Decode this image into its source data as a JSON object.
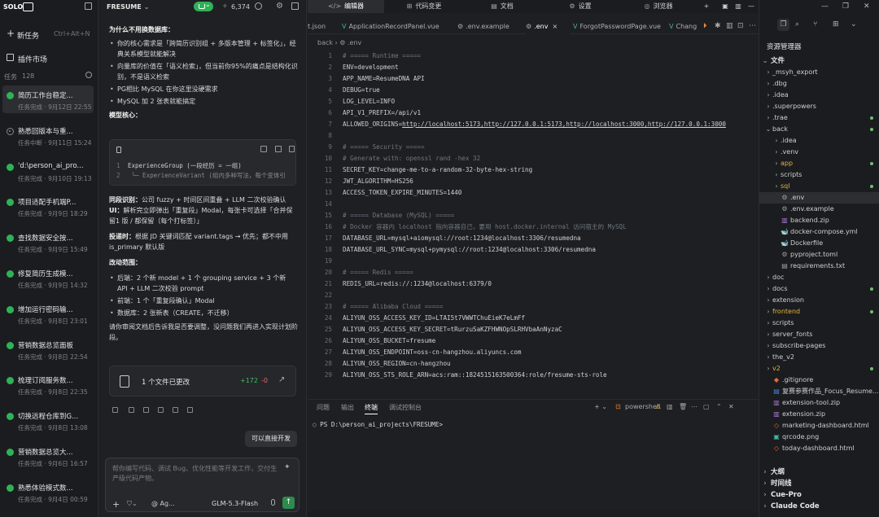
{
  "left": {
    "brand": "SOLO",
    "new_task": "新任务",
    "new_task_kbd": "Ctrl+Alt+N",
    "plugins": "插件市场",
    "tasks_label": "任务",
    "tasks_count": "128",
    "tasks": [
      {
        "title": "简历工作台稳定...",
        "sub": "任务完成 · 9月12日 22:55",
        "status": "done"
      },
      {
        "title": "熟悉回版本与重...",
        "sub": "任务中断 · 9月11日 15:24",
        "status": "interrupted"
      },
      {
        "title": "'d:\\person_ai_pro...",
        "sub": "任务完成 · 9月10日 19:13",
        "status": "done"
      },
      {
        "title": "项目适配手机端P...",
        "sub": "任务完成 · 9月9日 18:29",
        "status": "done"
      },
      {
        "title": "查找数据安全按...",
        "sub": "任务完成 · 9月9日 15:49",
        "status": "done"
      },
      {
        "title": "修复简历生成模...",
        "sub": "任务完成 · 9月9日 14:32",
        "status": "done"
      },
      {
        "title": "增加运行密码输...",
        "sub": "任务完成 · 9月8日 23:01",
        "status": "done"
      },
      {
        "title": "营销数据总览面板",
        "sub": "任务完成 · 9月8日 22:54",
        "status": "done"
      },
      {
        "title": "梳理订阅服务数...",
        "sub": "任务完成 · 9月8日 22:35",
        "status": "done"
      },
      {
        "title": "切换远程仓库到G...",
        "sub": "任务完成 · 9月8日 13:08",
        "status": "done"
      },
      {
        "title": "营销数据总览大...",
        "sub": "任务完成 · 9月6日 16:57",
        "status": "done"
      },
      {
        "title": "熟悉体验模式数...",
        "sub": "任务完成 · 9月4日 00:59",
        "status": "done"
      }
    ]
  },
  "chat": {
    "project": "FRESUME",
    "star_count": "6,374",
    "heading1": "为什么不用换数据库：",
    "bullets1": [
      "你的核心需求是「跨简历识别组 + 多版本管理 + 标签化」，经典关系模型就能解决",
      "向量库的价值在「语义检索」，但当前你95%的痛点是结构化识别，不是语义检索",
      "PG相比 MySQL 在你这里没硬需求",
      "MySQL 加 2 张表就能搞定"
    ],
    "heading2": "模型核心：",
    "code_lines": [
      {
        "n": "1",
        "code": "ExperienceGroup (一段经历 = 一组)"
      },
      {
        "n": "2",
        "code": "  └─ ExperienceVariant (组内多种写法，每个变体引"
      }
    ],
    "para1_bold": "同段识别：",
    "para1": "公司 fuzzy + 时间区间重叠 + LLM 二次校验确认",
    "para2_bold": "UI：",
    "para2": "解析完立即弹出「重复段」Modal，每张卡可选择「合并保留1 版 / 都保留（每个打标签）」",
    "para3_bold": "投递时：",
    "para3": "根据 JD 关键词匹配 variant.tags → 优先；都不中用 is_primary 默认版",
    "heading3": "改动范围：",
    "bullets2": [
      "后端：2 个新 model + 1 个 grouping service + 3 个新 API + LLM 二次校验 prompt",
      "前端：1 个「重复段确认」Modal",
      "数据库：2 张新表（CREATE，不迁移）"
    ],
    "closing": "请你审阅文档后告诉我是否要调整，没问题我们再进入实现计划阶段。",
    "file_change": "1 个文件已更改",
    "adds": "+172",
    "dels": "-0",
    "user_bubble": "可以直接开发",
    "input_placeholder": "帮你编写代码、调试 Bug、优化性能等开发工作，交付生产级代码产物。",
    "agent": "@ Ag...",
    "model": "GLM-5.3-Flash"
  },
  "editor": {
    "top_tabs": [
      "编辑器",
      "代码变更",
      "文档",
      "设置",
      "浏览器"
    ],
    "file_tabs": [
      {
        "name": "t.json",
        "icon": ""
      },
      {
        "name": "ApplicationRecordPanel.vue",
        "icon": "vue"
      },
      {
        "name": ".env.example",
        "icon": "settings"
      },
      {
        "name": ".env",
        "icon": "settings"
      },
      {
        "name": "ForgotPasswordPage.vue",
        "icon": "vue"
      },
      {
        "name": "Chang",
        "icon": "vue"
      }
    ],
    "breadcrumb": "back  ›  ⚙ .env",
    "lines": [
      {
        "n": "1",
        "t": "c",
        "text": "# ===== Runtime ====="
      },
      {
        "n": "2",
        "t": "kv",
        "k": "ENV",
        "v": "development"
      },
      {
        "n": "3",
        "t": "kv",
        "k": "APP_NAME",
        "v": "ResumeDNA API"
      },
      {
        "n": "4",
        "t": "kv",
        "k": "DEBUG",
        "v": "true"
      },
      {
        "n": "5",
        "t": "kv",
        "k": "LOG_LEVEL",
        "v": "INFO"
      },
      {
        "n": "6",
        "t": "kv",
        "k": "API_V1_PREFIX",
        "v": "/api/v1"
      },
      {
        "n": "7",
        "t": "kv",
        "k": "ALLOWED_ORIGINS",
        "v": "http://localhost:5173,http://127.0.0.1:5173,http://localhost:3000,http://127.0.0.1:3000",
        "link": true
      },
      {
        "n": "8",
        "t": "blank"
      },
      {
        "n": "9",
        "t": "c",
        "text": "# ===== Security ====="
      },
      {
        "n": "10",
        "t": "c",
        "text": "# Generate with: openssl rand -hex 32"
      },
      {
        "n": "11",
        "t": "kv",
        "k": "SECRET_KEY",
        "v": "change-me-to-a-random-32-byte-hex-string"
      },
      {
        "n": "12",
        "t": "kv",
        "k": "JWT_ALGORITHM",
        "v": "HS256"
      },
      {
        "n": "13",
        "t": "kv",
        "k": "ACCESS_TOKEN_EXPIRE_MINUTES",
        "v": "1440"
      },
      {
        "n": "14",
        "t": "blank"
      },
      {
        "n": "15",
        "t": "c",
        "text": "# ===== Database (MySQL) ====="
      },
      {
        "n": "16",
        "t": "c",
        "text": "# Docker 容器内 localhost 指向容器自己，要用 host.docker.internal 访问宿主的 MySQL"
      },
      {
        "n": "17",
        "t": "kv",
        "k": "DATABASE_URL",
        "v": "mysql+aiomysql://root:1234@localhost:3306/resumedna"
      },
      {
        "n": "18",
        "t": "kv",
        "k": "DATABASE_URL_SYNC",
        "v": "mysql+pymysql://root:1234@localhost:3306/resumedna"
      },
      {
        "n": "19",
        "t": "blank"
      },
      {
        "n": "20",
        "t": "c",
        "text": "# ===== Redis ====="
      },
      {
        "n": "21",
        "t": "kv",
        "k": "REDIS_URL",
        "v": "redis://:1234@localhost:6379/0"
      },
      {
        "n": "22",
        "t": "blank"
      },
      {
        "n": "23",
        "t": "c",
        "text": "# ===== Alibaba Cloud ====="
      },
      {
        "n": "24",
        "t": "kv",
        "k": "ALIYUN_OSS_ACCESS_KEY_ID",
        "v": "LTAI5t7VWWTChuEieK7eLmFf"
      },
      {
        "n": "25",
        "t": "kv",
        "k": "ALIYUN_OSS_ACCESS_KEY_SECRET",
        "v": "tRurzuSaKZFHWNOpSLRHVbaAnNyzaC"
      },
      {
        "n": "26",
        "t": "kv",
        "k": "ALIYUN_OSS_BUCKET",
        "v": "fresume"
      },
      {
        "n": "27",
        "t": "kv",
        "k": "ALIYUN_OSS_ENDPOINT",
        "v": "oss-cn-hangzhou.aliyuncs.com"
      },
      {
        "n": "28",
        "t": "kv",
        "k": "ALIYUN_OSS_REGION",
        "v": "cn-hangzhou"
      },
      {
        "n": "29",
        "t": "kv",
        "k": "ALIYUN_OSS_STS_ROLE_ARN",
        "v": "acs:ram::1824515163500364:role/fresume-sts-role"
      }
    ],
    "term_tabs": [
      "问题",
      "输出",
      "终端",
      "调试控制台"
    ],
    "shell": "powershell",
    "prompt": "PS D:\\person_ai_projects\\FRESUME>"
  },
  "explorer": {
    "title": "资源管理器",
    "root": "文件",
    "items": [
      {
        "depth": 1,
        "type": "dir",
        "open": false,
        "name": "_msyh_export"
      },
      {
        "depth": 1,
        "type": "dir",
        "open": false,
        "name": ".dbg"
      },
      {
        "depth": 1,
        "type": "dir",
        "open": false,
        "name": ".idea"
      },
      {
        "depth": 1,
        "type": "dir",
        "open": false,
        "name": ".superpowers"
      },
      {
        "depth": 1,
        "type": "dir",
        "open": false,
        "name": ".trae",
        "mod": true
      },
      {
        "depth": 1,
        "type": "dir",
        "open": true,
        "name": "back",
        "mod": true
      },
      {
        "depth": 2,
        "type": "dir",
        "open": false,
        "name": ".idea"
      },
      {
        "depth": 2,
        "type": "dir",
        "open": false,
        "name": ".venv"
      },
      {
        "depth": 2,
        "type": "dir",
        "open": false,
        "name": "app",
        "mod": true,
        "hl": true
      },
      {
        "depth": 2,
        "type": "dir",
        "open": false,
        "name": "scripts"
      },
      {
        "depth": 2,
        "type": "dir",
        "open": false,
        "name": "sql",
        "mod": true,
        "hl": true
      },
      {
        "depth": 2,
        "type": "file",
        "icon": "gear",
        "name": ".env",
        "sel": true
      },
      {
        "depth": 2,
        "type": "file",
        "icon": "gear",
        "name": ".env.example"
      },
      {
        "depth": 2,
        "type": "file",
        "icon": "zip",
        "name": "backend.zip"
      },
      {
        "depth": 2,
        "type": "file",
        "icon": "docker",
        "name": "docker-compose.yml"
      },
      {
        "depth": 2,
        "type": "file",
        "icon": "docker",
        "name": "Dockerfile"
      },
      {
        "depth": 2,
        "type": "file",
        "icon": "gear",
        "name": "pyproject.toml"
      },
      {
        "depth": 2,
        "type": "file",
        "icon": "txt",
        "name": "requirements.txt"
      },
      {
        "depth": 1,
        "type": "dir",
        "open": false,
        "name": "doc"
      },
      {
        "depth": 1,
        "type": "dir",
        "open": false,
        "name": "docs",
        "mod": true
      },
      {
        "depth": 1,
        "type": "dir",
        "open": false,
        "name": "extension"
      },
      {
        "depth": 1,
        "type": "dir",
        "open": false,
        "name": "frontend",
        "mod": true,
        "hl": true
      },
      {
        "depth": 1,
        "type": "dir",
        "open": false,
        "name": "scripts"
      },
      {
        "depth": 1,
        "type": "dir",
        "open": false,
        "name": "server_fonts"
      },
      {
        "depth": 1,
        "type": "dir",
        "open": false,
        "name": "subscribe-pages"
      },
      {
        "depth": 1,
        "type": "dir",
        "open": false,
        "name": "the_v2"
      },
      {
        "depth": 1,
        "type": "dir",
        "open": false,
        "name": "v2",
        "mod": true,
        "hl": true
      },
      {
        "depth": 1,
        "type": "file",
        "icon": "git",
        "name": ".gitignore"
      },
      {
        "depth": 1,
        "type": "file",
        "icon": "doc",
        "name": "复赛参赛作品_Focus_Resume..."
      },
      {
        "depth": 1,
        "type": "file",
        "icon": "zip",
        "name": "extension-tool.zip"
      },
      {
        "depth": 1,
        "type": "file",
        "icon": "zip",
        "name": "extension.zip"
      },
      {
        "depth": 1,
        "type": "file",
        "icon": "html",
        "name": "marketing-dashboard.html"
      },
      {
        "depth": 1,
        "type": "file",
        "icon": "img",
        "name": "qrcode.png"
      },
      {
        "depth": 1,
        "type": "file",
        "icon": "html",
        "name": "today-dashboard.html"
      }
    ],
    "sections": [
      "大纲",
      "时间线",
      "Cue-Pro",
      "Claude Code"
    ]
  },
  "colors": {
    "accent_green": "#2fb257",
    "folder_yellow": "#e0b341"
  }
}
